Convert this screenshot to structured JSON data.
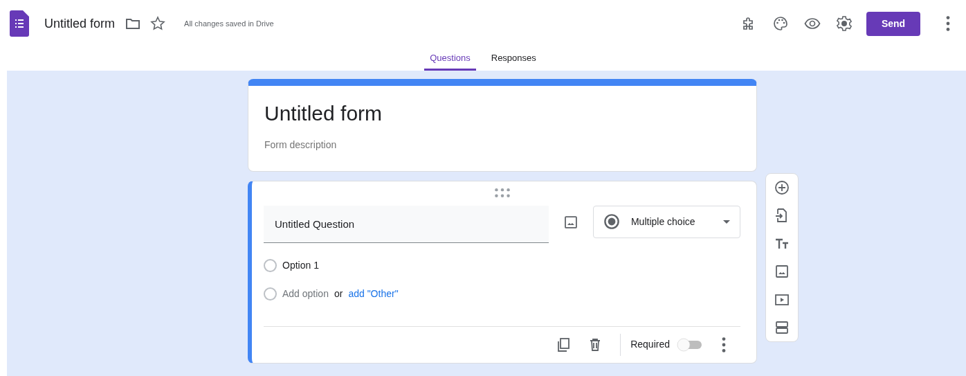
{
  "app": {
    "title": "Untitled form",
    "save_status": "All changes saved in Drive",
    "send_label": "Send"
  },
  "tabs": [
    {
      "label": "Questions",
      "selected": true
    },
    {
      "label": "Responses",
      "selected": false
    }
  ],
  "form": {
    "title": "Untitled form",
    "description_placeholder": "Form description"
  },
  "question": {
    "title": "Untitled Question",
    "type": "Multiple choice",
    "options": [
      {
        "label": "Option 1",
        "selected": false
      }
    ],
    "add_option": "Add option",
    "add_option_selected": false,
    "or": "or",
    "add_other": "add \"Other\"",
    "required_label": "Required",
    "required": false
  }
}
